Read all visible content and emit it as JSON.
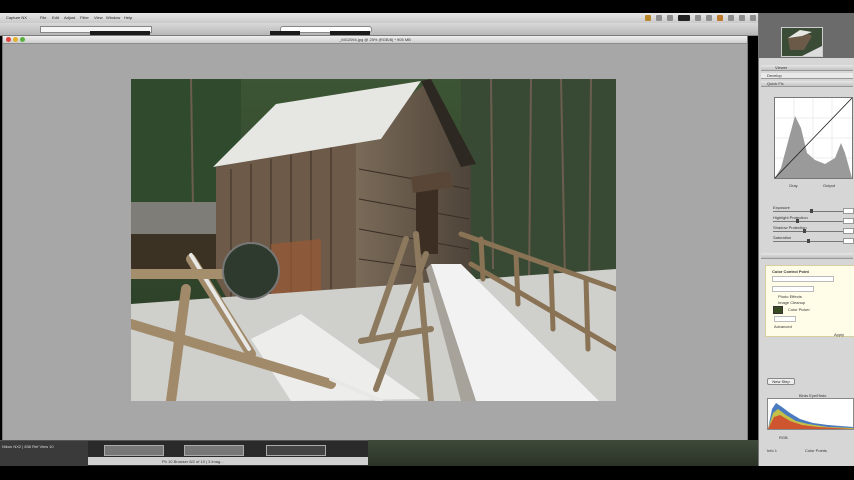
{
  "window": {
    "title": "_MG2094.jpg @ 25% (RGB/8) * 905 MB"
  },
  "menubar": {
    "items": [
      "Capture NX",
      "File",
      "Edit",
      "Adjust",
      "Filter",
      "View",
      "Window",
      "Help"
    ]
  },
  "film": {
    "left_label": "Nikon NX2 | 836 Ref View 10",
    "status": "Ph 10 Browser 8/2 of 10 | 3 imag..."
  },
  "panel": {
    "viewer_label": "Viewer",
    "layer_label": "Develop",
    "quick_fix": "Quick Fix",
    "curve_left": "Gray",
    "curve_right": "Output",
    "sliders": [
      {
        "label": "Exposure",
        "value": 0.55
      },
      {
        "label": "Highlight Protection",
        "value": 0.35
      },
      {
        "label": "Shadow Protection",
        "value": 0.45
      },
      {
        "label": "Saturation",
        "value": 0.5
      }
    ],
    "lab_header": "Color Control Point",
    "lab_rows": [
      "Photo Effects",
      "Image Cleanup",
      "Color Picker",
      "Advanced"
    ],
    "lab_apply": "Apply",
    "add_button": "New Step",
    "histogram_title": "Birds Eye/Histo",
    "bottom_labels": [
      "RGB",
      "Info 1",
      "Color Points"
    ],
    "colors": {
      "swatch": "#3a4a22",
      "accent": "#2a63b4"
    }
  }
}
